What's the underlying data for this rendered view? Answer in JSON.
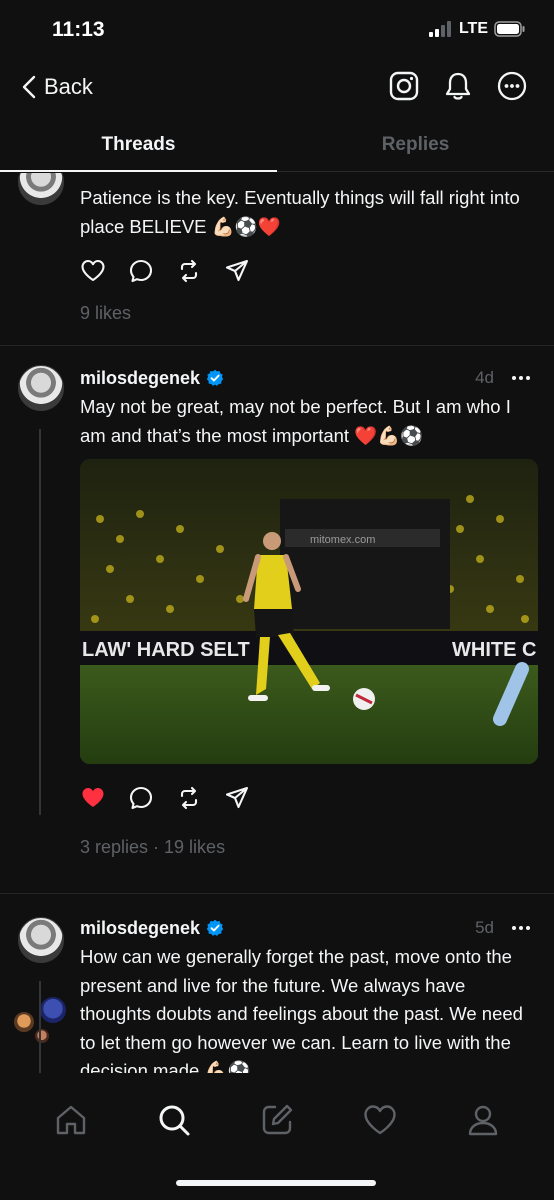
{
  "status_bar": {
    "time": "11:13",
    "network": "LTE"
  },
  "nav": {
    "back_label": "Back"
  },
  "tabs": [
    {
      "label": "Threads",
      "active": true
    },
    {
      "label": "Replies",
      "active": false
    }
  ],
  "posts": [
    {
      "username": "milosdegenek",
      "text": "Patience is the key. Eventually things will fall right into place BELIEVE 💪🏻⚽❤️",
      "likes": "9 likes"
    },
    {
      "username": "milosdegenek",
      "time": "4d",
      "text": "May not be great, may not be perfect. But I am who I am and that’s the most important ❤️💪🏻⚽",
      "image_text": {
        "board_left": "LAW' HARD SELT",
        "board_right": "WHITE C",
        "banner": "mitomex.com"
      },
      "meta": "3 replies · 19 likes",
      "liked": true
    },
    {
      "username": "milosdegenek",
      "time": "5d",
      "text": "How can we generally forget the past, move onto the present and live for the future. We always have thoughts doubts and feelings about the past. We need to let them go however we can. Learn to live with the decision made 💪🏻⚽"
    }
  ],
  "icons": {
    "back": "chevron-left-icon",
    "instagram": "instagram-icon",
    "notifications": "bell-icon",
    "more": "more-circle-icon",
    "tabbar": [
      "home-icon",
      "search-icon",
      "compose-icon",
      "heart-icon",
      "profile-icon"
    ]
  },
  "colors": {
    "background": "#101010",
    "text": "#f3f5f7",
    "muted": "#5e6166",
    "verified": "#0095f6",
    "liked": "#ff3040"
  }
}
